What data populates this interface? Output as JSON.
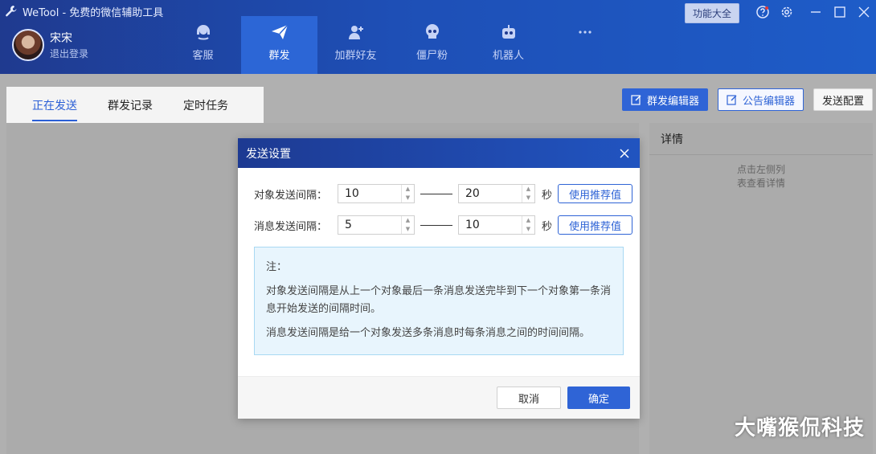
{
  "app": {
    "title": "WeTool - 免费的微信辅助工具"
  },
  "user": {
    "name": "宋宋",
    "logout": "退出登录"
  },
  "nav": {
    "items": [
      {
        "label": "客服",
        "icon": "headset-icon"
      },
      {
        "label": "群发",
        "icon": "paper-plane-icon"
      },
      {
        "label": "加群好友",
        "icon": "add-friend-icon"
      },
      {
        "label": "僵尸粉",
        "icon": "skull-icon"
      },
      {
        "label": "机器人",
        "icon": "robot-icon"
      },
      {
        "label": "",
        "icon": "more-icon"
      }
    ],
    "active": "群发"
  },
  "window": {
    "feature_button": "功能大全"
  },
  "tabs": [
    {
      "label": "正在发送",
      "active": true
    },
    {
      "label": "群发记录",
      "active": false
    },
    {
      "label": "定时任务",
      "active": false
    }
  ],
  "actions": {
    "group_editor": "群发编辑器",
    "notice_editor": "公告编辑器",
    "send_config": "发送配置"
  },
  "details": {
    "title": "详情",
    "hint_line1": "点击左侧列",
    "hint_line2": "表查看详情"
  },
  "dialog": {
    "title": "发送设置",
    "object_interval": {
      "label": "对象发送间隔：",
      "min": "10",
      "max": "20",
      "unit": "秒",
      "recommend": "使用推荐值"
    },
    "message_interval": {
      "label": "消息发送间隔：",
      "min": "5",
      "max": "10",
      "unit": "秒",
      "recommend": "使用推荐值"
    },
    "note": {
      "heading": "注：",
      "line1": "对象发送间隔是从上一个对象最后一条消息发送完毕到下一个对象第一条消息开始发送的间隔时间。",
      "line2": "消息发送间隔是给一个对象发送多条消息时每条消息之间的时间间隔。"
    },
    "cancel": "取消",
    "ok": "确定"
  },
  "watermark": "大嘴猴侃科技",
  "colors": {
    "primary": "#2f64d6",
    "header_dark": "#1f3a8f",
    "note_bg": "#e8f5fd"
  }
}
